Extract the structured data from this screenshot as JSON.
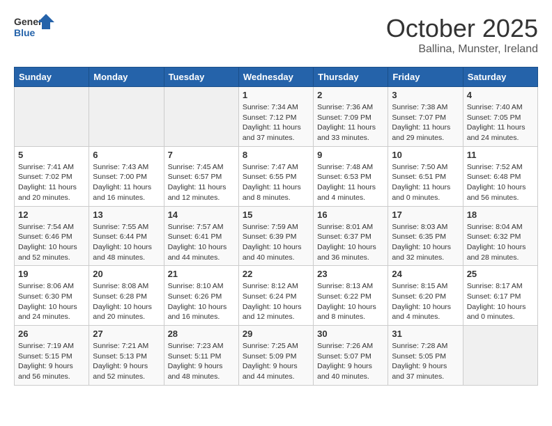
{
  "header": {
    "logo_general": "General",
    "logo_blue": "Blue",
    "month_title": "October 2025",
    "location": "Ballina, Munster, Ireland"
  },
  "weekdays": [
    "Sunday",
    "Monday",
    "Tuesday",
    "Wednesday",
    "Thursday",
    "Friday",
    "Saturday"
  ],
  "weeks": [
    [
      {
        "day": "",
        "info": ""
      },
      {
        "day": "",
        "info": ""
      },
      {
        "day": "",
        "info": ""
      },
      {
        "day": "1",
        "info": "Sunrise: 7:34 AM\nSunset: 7:12 PM\nDaylight: 11 hours\nand 37 minutes."
      },
      {
        "day": "2",
        "info": "Sunrise: 7:36 AM\nSunset: 7:09 PM\nDaylight: 11 hours\nand 33 minutes."
      },
      {
        "day": "3",
        "info": "Sunrise: 7:38 AM\nSunset: 7:07 PM\nDaylight: 11 hours\nand 29 minutes."
      },
      {
        "day": "4",
        "info": "Sunrise: 7:40 AM\nSunset: 7:05 PM\nDaylight: 11 hours\nand 24 minutes."
      }
    ],
    [
      {
        "day": "5",
        "info": "Sunrise: 7:41 AM\nSunset: 7:02 PM\nDaylight: 11 hours\nand 20 minutes."
      },
      {
        "day": "6",
        "info": "Sunrise: 7:43 AM\nSunset: 7:00 PM\nDaylight: 11 hours\nand 16 minutes."
      },
      {
        "day": "7",
        "info": "Sunrise: 7:45 AM\nSunset: 6:57 PM\nDaylight: 11 hours\nand 12 minutes."
      },
      {
        "day": "8",
        "info": "Sunrise: 7:47 AM\nSunset: 6:55 PM\nDaylight: 11 hours\nand 8 minutes."
      },
      {
        "day": "9",
        "info": "Sunrise: 7:48 AM\nSunset: 6:53 PM\nDaylight: 11 hours\nand 4 minutes."
      },
      {
        "day": "10",
        "info": "Sunrise: 7:50 AM\nSunset: 6:51 PM\nDaylight: 11 hours\nand 0 minutes."
      },
      {
        "day": "11",
        "info": "Sunrise: 7:52 AM\nSunset: 6:48 PM\nDaylight: 10 hours\nand 56 minutes."
      }
    ],
    [
      {
        "day": "12",
        "info": "Sunrise: 7:54 AM\nSunset: 6:46 PM\nDaylight: 10 hours\nand 52 minutes."
      },
      {
        "day": "13",
        "info": "Sunrise: 7:55 AM\nSunset: 6:44 PM\nDaylight: 10 hours\nand 48 minutes."
      },
      {
        "day": "14",
        "info": "Sunrise: 7:57 AM\nSunset: 6:41 PM\nDaylight: 10 hours\nand 44 minutes."
      },
      {
        "day": "15",
        "info": "Sunrise: 7:59 AM\nSunset: 6:39 PM\nDaylight: 10 hours\nand 40 minutes."
      },
      {
        "day": "16",
        "info": "Sunrise: 8:01 AM\nSunset: 6:37 PM\nDaylight: 10 hours\nand 36 minutes."
      },
      {
        "day": "17",
        "info": "Sunrise: 8:03 AM\nSunset: 6:35 PM\nDaylight: 10 hours\nand 32 minutes."
      },
      {
        "day": "18",
        "info": "Sunrise: 8:04 AM\nSunset: 6:32 PM\nDaylight: 10 hours\nand 28 minutes."
      }
    ],
    [
      {
        "day": "19",
        "info": "Sunrise: 8:06 AM\nSunset: 6:30 PM\nDaylight: 10 hours\nand 24 minutes."
      },
      {
        "day": "20",
        "info": "Sunrise: 8:08 AM\nSunset: 6:28 PM\nDaylight: 10 hours\nand 20 minutes."
      },
      {
        "day": "21",
        "info": "Sunrise: 8:10 AM\nSunset: 6:26 PM\nDaylight: 10 hours\nand 16 minutes."
      },
      {
        "day": "22",
        "info": "Sunrise: 8:12 AM\nSunset: 6:24 PM\nDaylight: 10 hours\nand 12 minutes."
      },
      {
        "day": "23",
        "info": "Sunrise: 8:13 AM\nSunset: 6:22 PM\nDaylight: 10 hours\nand 8 minutes."
      },
      {
        "day": "24",
        "info": "Sunrise: 8:15 AM\nSunset: 6:20 PM\nDaylight: 10 hours\nand 4 minutes."
      },
      {
        "day": "25",
        "info": "Sunrise: 8:17 AM\nSunset: 6:17 PM\nDaylight: 10 hours\nand 0 minutes."
      }
    ],
    [
      {
        "day": "26",
        "info": "Sunrise: 7:19 AM\nSunset: 5:15 PM\nDaylight: 9 hours\nand 56 minutes."
      },
      {
        "day": "27",
        "info": "Sunrise: 7:21 AM\nSunset: 5:13 PM\nDaylight: 9 hours\nand 52 minutes."
      },
      {
        "day": "28",
        "info": "Sunrise: 7:23 AM\nSunset: 5:11 PM\nDaylight: 9 hours\nand 48 minutes."
      },
      {
        "day": "29",
        "info": "Sunrise: 7:25 AM\nSunset: 5:09 PM\nDaylight: 9 hours\nand 44 minutes."
      },
      {
        "day": "30",
        "info": "Sunrise: 7:26 AM\nSunset: 5:07 PM\nDaylight: 9 hours\nand 40 minutes."
      },
      {
        "day": "31",
        "info": "Sunrise: 7:28 AM\nSunset: 5:05 PM\nDaylight: 9 hours\nand 37 minutes."
      },
      {
        "day": "",
        "info": ""
      }
    ]
  ]
}
